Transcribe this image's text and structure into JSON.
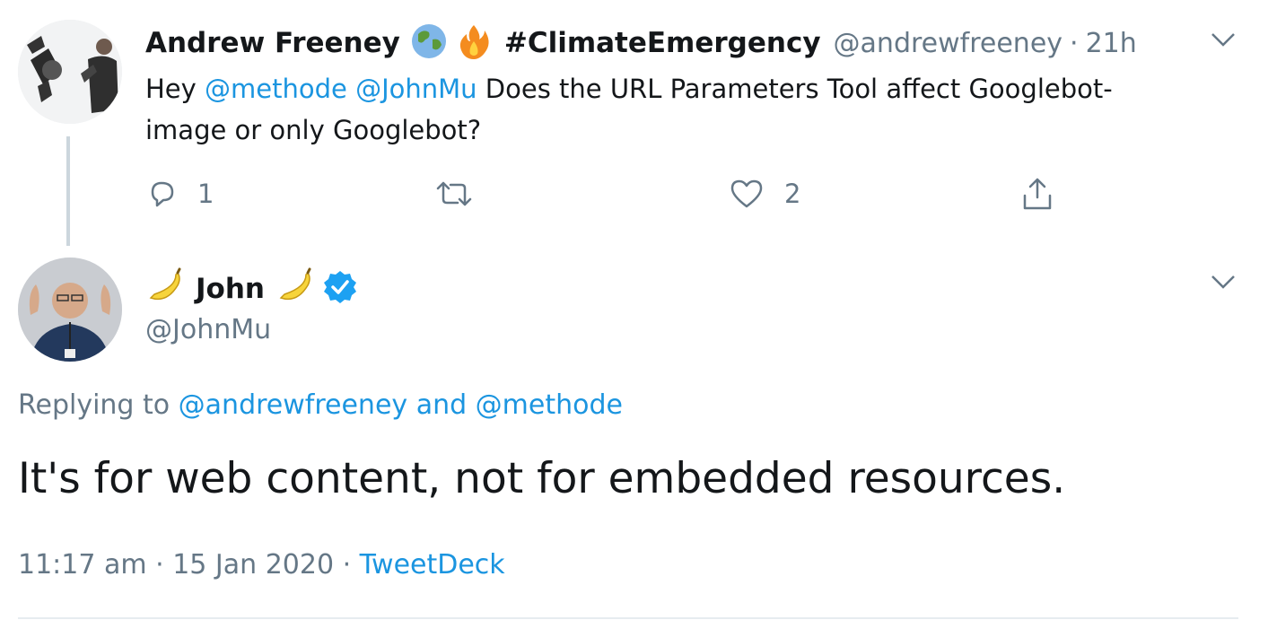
{
  "tweet1": {
    "display_name": "Andrew Freeney",
    "hashtag": "#ClimateEmergency",
    "handle": "@andrewfreeney",
    "separator": "·",
    "time": "21h",
    "text_prefix": "Hey ",
    "mention1": "@methode",
    "mention2": "@JohnMu",
    "text_line1": " Does the URL Parameters Tool affect Googlebot-",
    "text_line2": "image or only Googlebot?",
    "reply_count": "1",
    "like_count": "2",
    "icons": [
      "earth-icon",
      "fire-icon",
      "reply-icon",
      "retweet-icon",
      "like-icon",
      "share-icon",
      "chevron-down-icon"
    ]
  },
  "tweet2": {
    "display_name": "John",
    "handle": "@JohnMu",
    "replying_prefix": "Replying to ",
    "replying_user1": "@andrewfreeney",
    "replying_and": " and ",
    "replying_user2": "@methode",
    "text": "It's for web content, not for embedded resources.",
    "time": "11:17 am",
    "date_sep": " · ",
    "date": "15 Jan 2020",
    "source_sep": " · ",
    "source": "TweetDeck",
    "icons": [
      "banana-icon",
      "verified-badge-icon",
      "chevron-down-icon"
    ]
  },
  "colors": {
    "link": "#1b95e0",
    "muted": "#657786",
    "text": "#14171a",
    "verified": "#1da1f2"
  }
}
